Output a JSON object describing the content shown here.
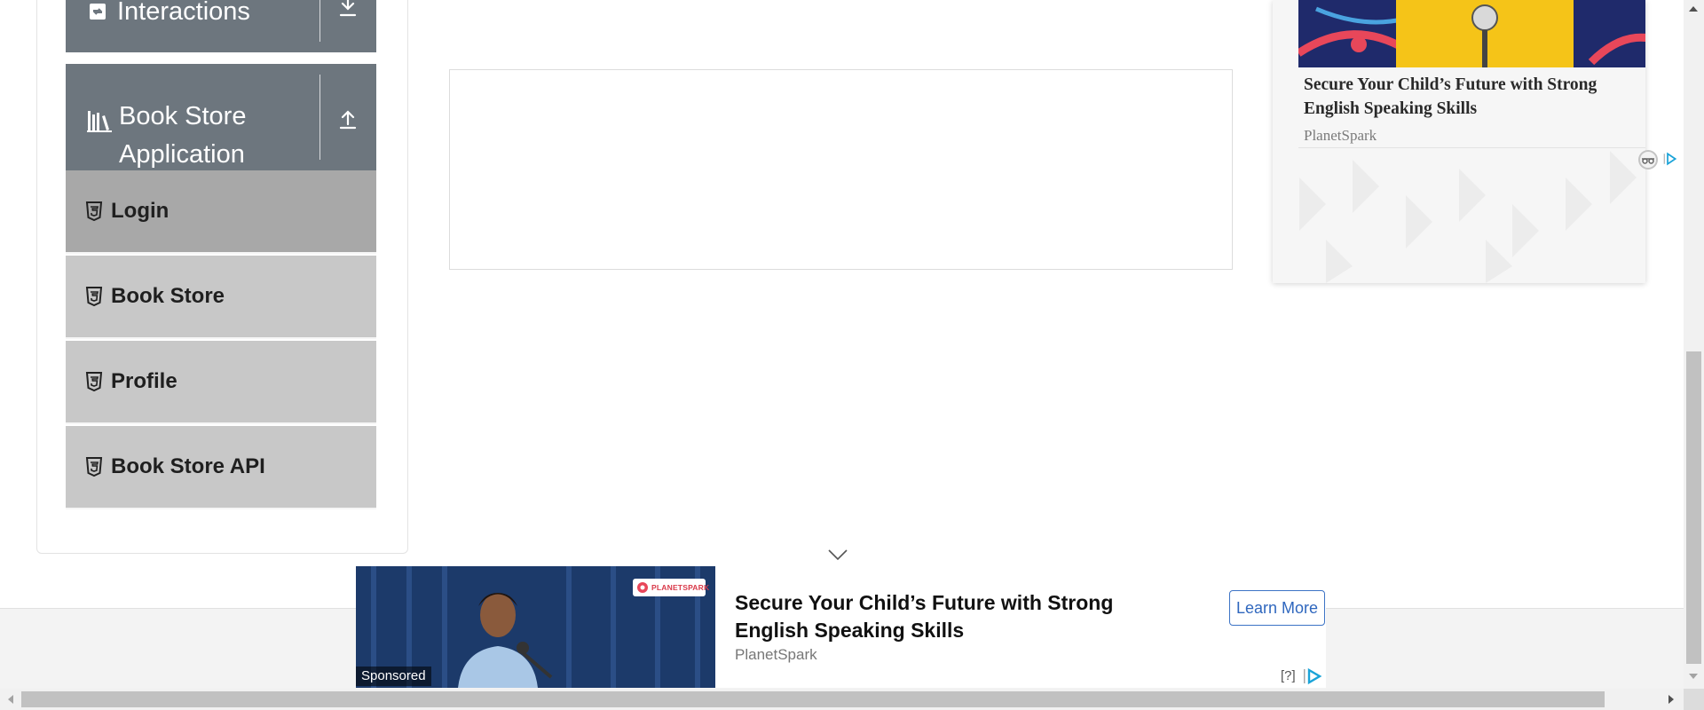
{
  "sidebar": {
    "groups": [
      {
        "title_lines": [
          "Interactions"
        ],
        "icon": "interactions-icon",
        "toggle": "download-arrow-icon"
      },
      {
        "title_lines": [
          "Book Store",
          "Application"
        ],
        "icon": "book-store-icon",
        "toggle": "upload-arrow-icon"
      }
    ],
    "items": [
      {
        "label": "Login",
        "icon": "html5-icon",
        "active": true
      },
      {
        "label": "Book Store",
        "icon": "html5-icon",
        "active": false
      },
      {
        "label": "Profile",
        "icon": "html5-icon",
        "active": false
      },
      {
        "label": "Book Store API",
        "icon": "html5-icon",
        "active": false
      }
    ]
  },
  "right_ad": {
    "headline": "Secure Your Child’s Future with Strong English Speaking Skills",
    "advertiser": "PlanetSpark",
    "icons": [
      "privacy-icon",
      "adchoices-icon"
    ]
  },
  "bottom_ad": {
    "sponsored": "Sponsored",
    "headline": "Secure Your Child’s Future with Strong English Speaking Skills",
    "advertiser": "PlanetSpark",
    "cta": "Learn More",
    "help": "[?]",
    "logo_text": "PLANETSPARK"
  },
  "colors": {
    "group_header_bg": "#6d767e",
    "menu_item_bg": "#c8c8c8",
    "menu_item_active_bg": "#a8a8a8",
    "cta_border": "#3c73c5"
  }
}
